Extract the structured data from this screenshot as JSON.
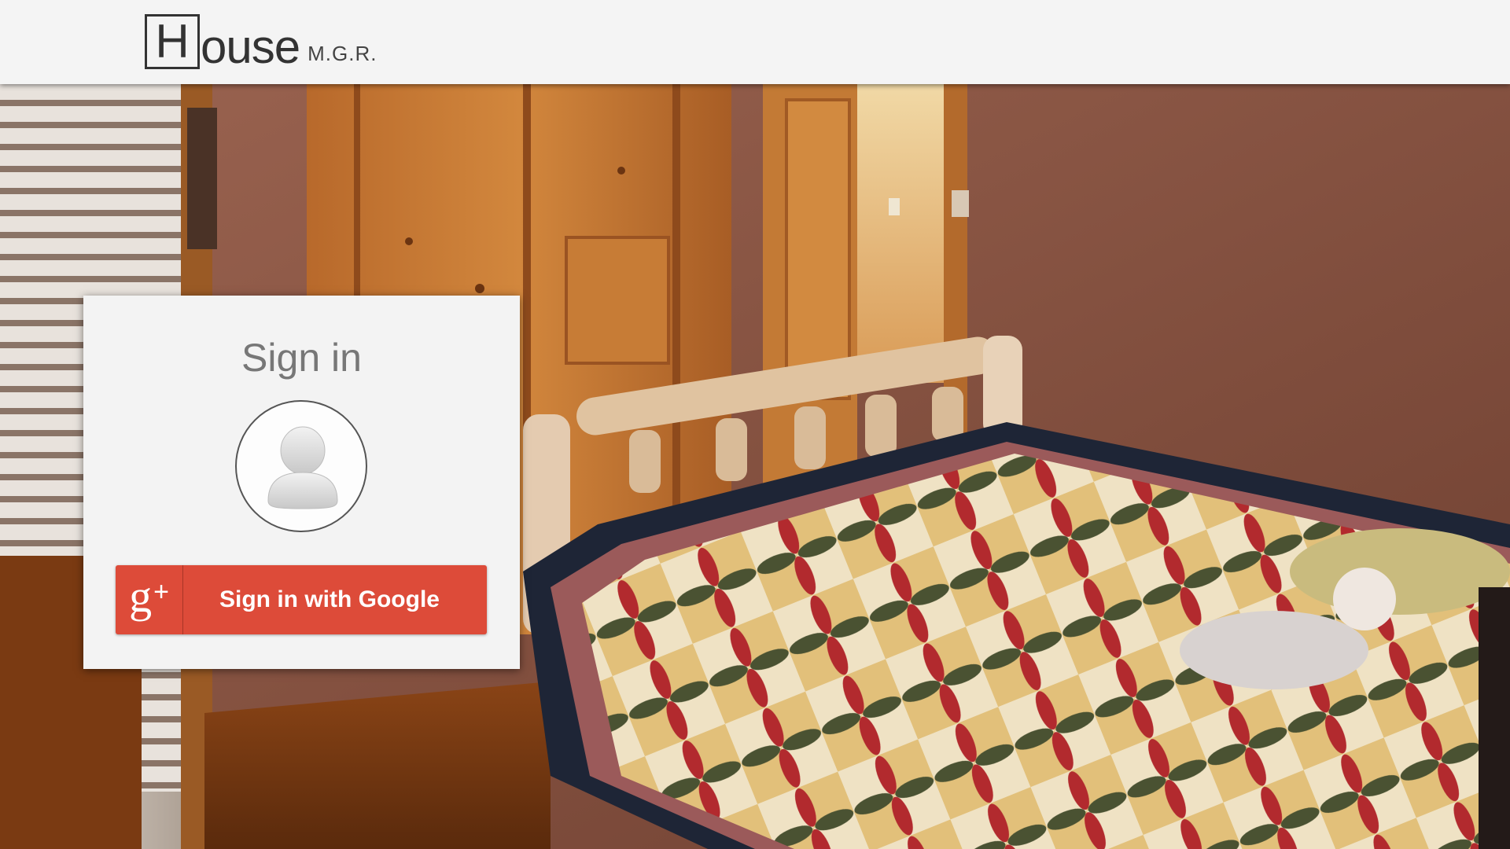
{
  "header": {
    "logo_letter": "H",
    "logo_word": "ouse",
    "logo_sub": "M.G.R."
  },
  "signin": {
    "title": "Sign in",
    "button_label": "Sign in with Google",
    "button_icon": "google-plus-icon",
    "avatar_icon": "default-user-icon"
  },
  "colors": {
    "header_bg": "#f4f4f4",
    "card_bg": "#f3f3f3",
    "google_red": "#dd4b39",
    "title_gray": "#777777"
  }
}
